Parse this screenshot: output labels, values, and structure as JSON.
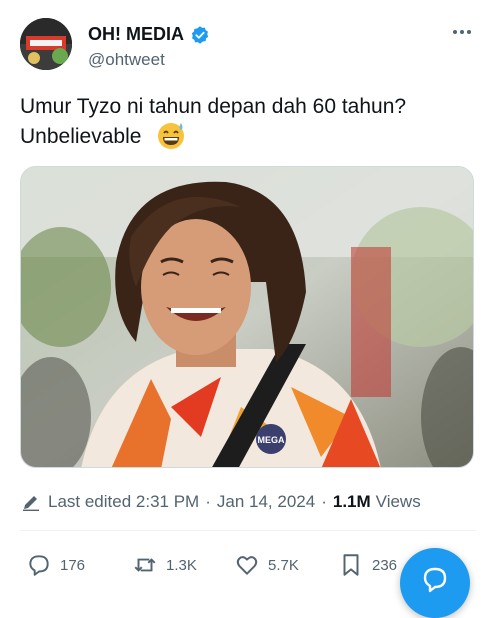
{
  "author": {
    "display_name": "OH! MEDIA",
    "handle": "@ohtweet",
    "verified_color": "#1d9bf0"
  },
  "tweet": {
    "text": "Umur Tyzo ni tahun depan dah 60 tahun?\nUnbelievable",
    "emoji": "grinning-face-with-sweat-icon"
  },
  "media": {
    "shirt_logo": "MEGA"
  },
  "meta": {
    "edited_label": "Last edited 2:31 PM",
    "date": "Jan 14, 2024",
    "views_count": "1.1M",
    "views_label": "Views"
  },
  "actions": {
    "replies": "176",
    "reposts": "1.3K",
    "likes": "5.7K",
    "bookmarks": "236"
  },
  "colors": {
    "accent": "#1d9bf0",
    "text": "#0f1419",
    "muted": "#536471"
  }
}
